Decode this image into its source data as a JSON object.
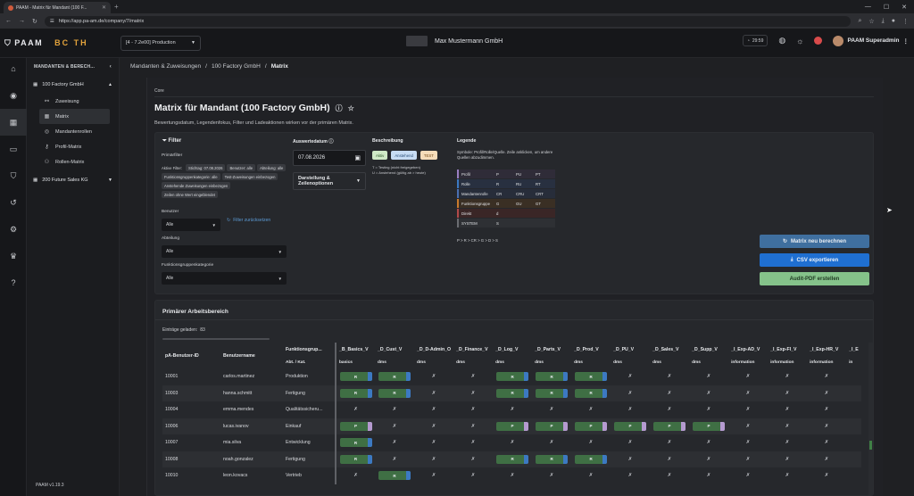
{
  "browser": {
    "tab_title": "PAAM - Matrix für Mandant (100 F...",
    "url": "https://app.pa-am.de/company/7/matrix"
  },
  "app": {
    "logo_text": "PAAM",
    "logo2_text": "BC TH",
    "environment": "[4 - 7.2e00] Production",
    "company_name": "Max Mustermann GmbH",
    "timer": "29:59",
    "user_name": "PAAM Superadmin"
  },
  "sidebar": {
    "header": "MANDANTEN & BERECH...",
    "group1": "100 Factory GmbH",
    "items": [
      {
        "label": "Zuweisung",
        "icon": "link-icon"
      },
      {
        "label": "Matrix",
        "icon": "grid-icon"
      },
      {
        "label": "Mandantenrollen",
        "icon": "badge-icon"
      },
      {
        "label": "Profil-Matrix",
        "icon": "key-icon"
      },
      {
        "label": "Rollen-Matrix",
        "icon": "people-icon"
      }
    ],
    "group2": "200 Future Sales KG",
    "version": "PAAM v1.19.3"
  },
  "breadcrumb": {
    "a": "Mandanten & Zuweisungen",
    "b": "100 Factory GmbH",
    "c": "Matrix"
  },
  "page": {
    "section_label": "Core",
    "title": "Matrix für Mandant (100 Factory GmbH)",
    "subtitle": "Bewertungsdatum, Legendenfokus, Filter und Ladeaktionen wirken vor der primären Matrix."
  },
  "filter": {
    "title": "Filter",
    "primary_label": "Primärfilter",
    "active_label": "Aktive Filter:",
    "chips": [
      "Stichtag: 07.08.2026",
      "Benutzer: alle",
      "Abteilung: alle",
      "Funktionsgruppenkategorie: alle",
      "Test-Zuweisungen einbezogen",
      "Anstehende Zuweisungen einbezogen",
      "Zeilen ohne Wert eingeblendet"
    ],
    "benutzer_label": "Benutzer",
    "benutzer_value": "Alle",
    "reset_label": "Filter zurücksetzen",
    "abteilung_label": "Abteilung",
    "abteilung_value": "Alle",
    "fkat_label": "Funktionsgruppenkategorie",
    "fkat_value": "Alle"
  },
  "auswertung": {
    "label": "Auswertedatum",
    "date": "07.08.2026",
    "darstellung_line1": "Darstellung &",
    "darstellung_line2": "Zeilenoptionen"
  },
  "beschreibung": {
    "label": "Beschreibung",
    "badge_aktiv": "Aktiv",
    "badge_anstehend": "Anstehend",
    "badge_test": "TEST",
    "line1": "T = Testing (nicht freigegeben)",
    "line2": "U = Anstehend (gültig ab > heute)"
  },
  "legende": {
    "label": "Legende",
    "note": "Symbole: Profil/Rolle/Quelle. Zeile anklicken, um andere Quellen abzudimmen.",
    "rows": [
      {
        "name": "Profil",
        "c1": "P",
        "c2": "PU",
        "c3": "PT",
        "color": "#9a7fc2"
      },
      {
        "name": "Rolle",
        "c1": "R",
        "c2": "RU",
        "c3": "RT",
        "color": "#3c79c2"
      },
      {
        "name": "Mandantenrolle",
        "c1": "CR",
        "c2": "CRU",
        "c3": "CRT",
        "color": "#4a6fb0"
      },
      {
        "name": "Funktionsgruppe",
        "c1": "G",
        "c2": "GU",
        "c3": "GT",
        "color": "#c97a2c"
      },
      {
        "name": "Direkt",
        "c1": "d",
        "c2": "",
        "c3": "",
        "color": "#b04a4a"
      },
      {
        "name": "SYSTEM",
        "c1": "S",
        "c2": "",
        "c3": "",
        "color": "#6b6d72"
      }
    ],
    "footer": "P > R > CR > G > D > S"
  },
  "actions": {
    "recalc": "Matrix neu berechnen",
    "csv": "CSV exportieren",
    "pdf": "Audit-PDF erstellen"
  },
  "matrix": {
    "title": "Primärer Arbeitsbereich",
    "loaded_label": "Einträge geladen:",
    "loaded_count": "83",
    "headers": [
      "pA-Benutzer-ID",
      "Benutzername",
      "Funktionsgrup..."
    ],
    "sub_header": "Abt. / Kat.",
    "columns": [
      {
        "name": "_B_Basics_V",
        "cat": "basics"
      },
      {
        "name": "_D_Cust_V",
        "cat": "dms"
      },
      {
        "name": "_D_D-Admin_O",
        "cat": "dms"
      },
      {
        "name": "_D_Finance_V",
        "cat": "dms"
      },
      {
        "name": "_D_Log_V",
        "cat": "dms"
      },
      {
        "name": "_D_Parts_V",
        "cat": "dms"
      },
      {
        "name": "_D_Prod_V",
        "cat": "dms"
      },
      {
        "name": "_D_PU_V",
        "cat": "dms"
      },
      {
        "name": "_D_Sales_V",
        "cat": "dms"
      },
      {
        "name": "_D_Supp_V",
        "cat": "dms"
      },
      {
        "name": "_I_Exp-AD_V",
        "cat": "information"
      },
      {
        "name": "_I_Exp-FI_V",
        "cat": "information"
      },
      {
        "name": "_I_Exp-HR_V",
        "cat": "information"
      },
      {
        "name": "_I_E",
        "cat": "in"
      }
    ],
    "rows": [
      {
        "id": "10001",
        "user": "carlos.martinez",
        "dept": "Produktion",
        "cells": [
          "R",
          "R",
          "x",
          "x",
          "R",
          "R",
          "R",
          "x",
          "x",
          "x",
          "x",
          "x",
          "x",
          ""
        ]
      },
      {
        "id": "10003",
        "user": "hanna.schmitt",
        "dept": "Fertigung",
        "cells": [
          "R",
          "R",
          "x",
          "x",
          "R",
          "R",
          "R",
          "x",
          "x",
          "x",
          "x",
          "x",
          "x",
          ""
        ]
      },
      {
        "id": "10004",
        "user": "emma.mendes",
        "dept": "Qualitätssicheru...",
        "cells": [
          "x",
          "x",
          "x",
          "x",
          "x",
          "x",
          "x",
          "x",
          "x",
          "x",
          "x",
          "x",
          "x",
          ""
        ]
      },
      {
        "id": "10006",
        "user": "lucas.ivanov",
        "dept": "Einkauf",
        "cells": [
          "P",
          "x",
          "x",
          "x",
          "P",
          "P",
          "P",
          "P",
          "P",
          "P",
          "x",
          "x",
          "x",
          ""
        ]
      },
      {
        "id": "10007",
        "user": "mia.silva",
        "dept": "Entwicklung",
        "cells": [
          "R",
          "x",
          "x",
          "x",
          "x",
          "x",
          "x",
          "x",
          "x",
          "x",
          "x",
          "x",
          "x",
          ""
        ]
      },
      {
        "id": "10008",
        "user": "noah.gonzalez",
        "dept": "Fertigung",
        "cells": [
          "R",
          "x",
          "x",
          "x",
          "R",
          "R",
          "R",
          "x",
          "x",
          "x",
          "x",
          "x",
          "x",
          ""
        ]
      },
      {
        "id": "10010",
        "user": "leon.kovacs",
        "dept": "Vertrieb",
        "cells": [
          "x",
          "R",
          "x",
          "x",
          "x",
          "x",
          "x",
          "x",
          "x",
          "x",
          "x",
          "x",
          "x",
          ""
        ]
      }
    ]
  }
}
